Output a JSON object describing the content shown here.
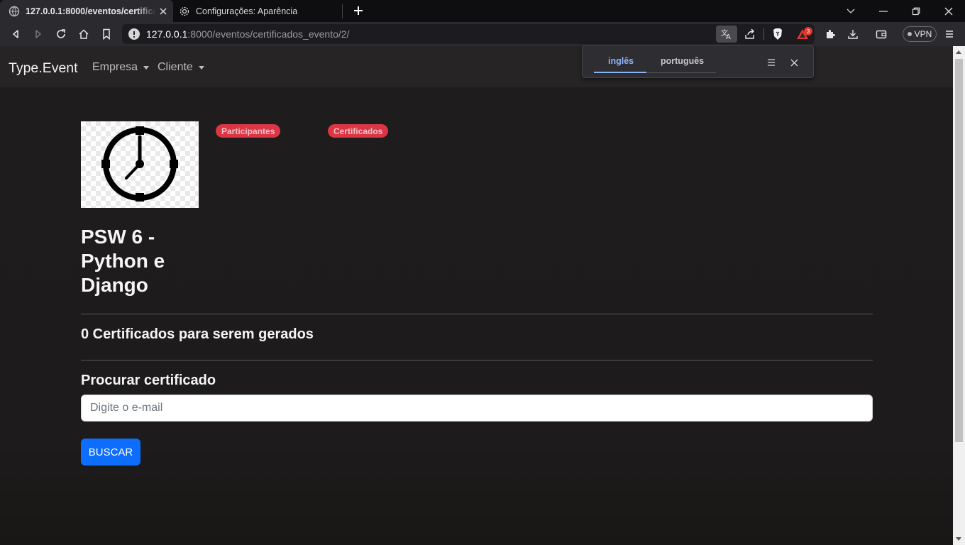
{
  "browser": {
    "tabs": [
      {
        "title": "127.0.0.1:8000/eventos/certificados_evento/2/",
        "active": true
      },
      {
        "title": "Configurações: Aparência",
        "active": false
      }
    ],
    "url": {
      "host": "127.0.0.1",
      "rest": ":8000/eventos/certificados_evento/2/"
    },
    "vpn_label": "VPN",
    "rewards_badge": "3",
    "translate": {
      "source_lang": "inglês",
      "target_lang": "português"
    }
  },
  "navbar": {
    "brand": "Type.Event",
    "menus": [
      "Empresa",
      "Cliente"
    ]
  },
  "event": {
    "title": "PSW 6 - Python e Django",
    "tags": [
      "Participantes",
      "Certificados"
    ]
  },
  "certificates": {
    "count_heading": "0 Certificados para serem gerados",
    "search_heading": "Procurar certificado",
    "email_placeholder": "Digite o e-mail",
    "search_button": "BUSCAR"
  },
  "colors": {
    "accent": "#0d6efd",
    "pill": "#dc3545",
    "background": "#1d1b1b",
    "navbar": "#262424"
  }
}
